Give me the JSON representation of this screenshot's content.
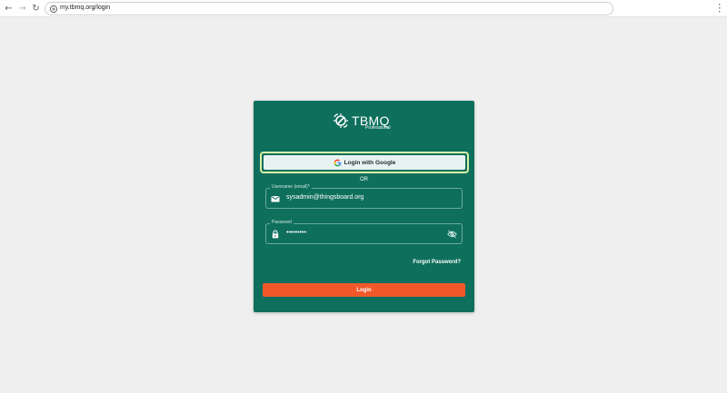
{
  "browser": {
    "url": "my.tbmq.org/login"
  },
  "logo": {
    "name": "TBMQ",
    "edition": "Professional"
  },
  "login_form": {
    "google_button_label": "Login with Google",
    "divider_text": "OR",
    "username": {
      "label": "Username (email)*",
      "value": "sysadmin@thingsboard.org"
    },
    "password": {
      "label": "Password",
      "masked_value": "•••••••••"
    },
    "forgot_password_label": "Forgot Password?",
    "login_button_label": "Login"
  },
  "colors": {
    "card_background": "#0e6f5c",
    "login_button": "#f0582a",
    "focus_ring": "#d9f0a8",
    "page_background": "#efefef"
  },
  "icons": {
    "username_field": "mail-icon",
    "password_field": "lock-icon",
    "password_toggle": "visibility-off-icon",
    "google": "google-g-icon"
  }
}
